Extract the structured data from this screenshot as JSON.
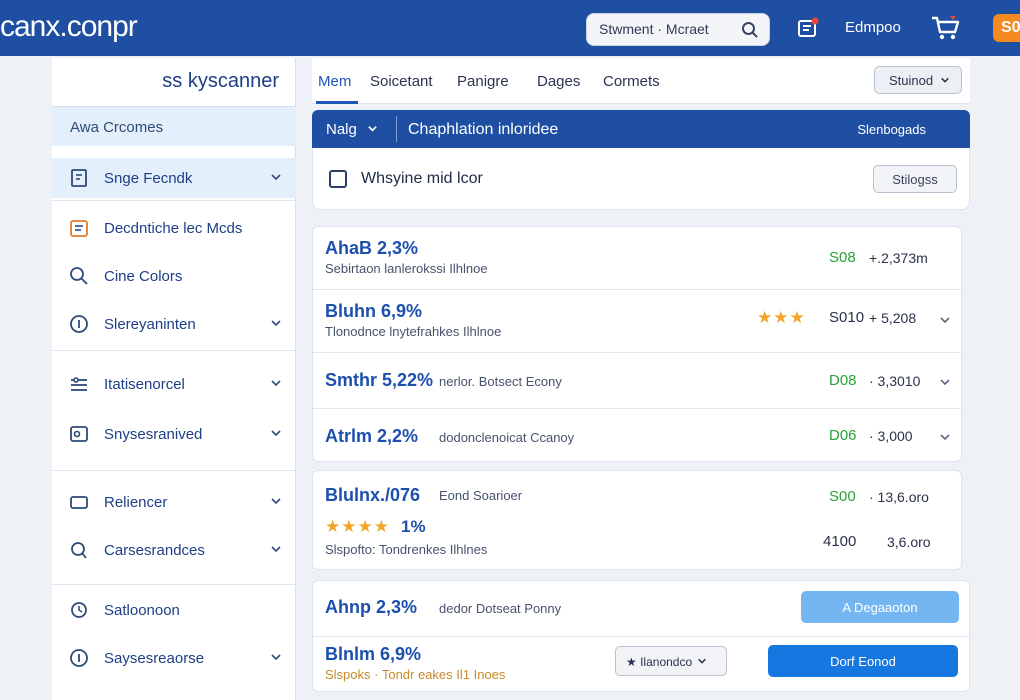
{
  "header": {
    "logo": "canx.conpr",
    "search_value": "Stwment · Mcraet",
    "link": "Edmpoo",
    "badge": "S0"
  },
  "sidebar": {
    "brand": "ss kyscanner",
    "heading": "Awa Crcomes",
    "items": [
      {
        "label": "Snge Fecndk"
      },
      {
        "label": "Decdntiche lec Mcds"
      },
      {
        "label": "Cine Colors"
      },
      {
        "label": "Slereyaninten"
      },
      {
        "label": "Itatisenorcel"
      },
      {
        "label": "Snysesranived"
      },
      {
        "label": "Reliencer"
      },
      {
        "label": "Carsesrandces"
      },
      {
        "label": "Satloonoon"
      },
      {
        "label": "Saysesreaorse"
      }
    ]
  },
  "tabs": {
    "items": [
      "Mem",
      "Soicetant",
      "Panigre",
      "Dages",
      "Cormets"
    ],
    "dropdown": "Stuinod"
  },
  "bluebar": {
    "left": "Nalg",
    "title": "Chaphlation inloridee",
    "right": "Slenbogads"
  },
  "filter": {
    "label": "Whsyine mid lcor",
    "button": "Stilogss"
  },
  "results": {
    "r1": {
      "title": "AhaB 2,3%",
      "sub": "Sebirtaon lanlerokssi Ilhlnoe",
      "price": "S08",
      "amount": "+.2,373m"
    },
    "r2": {
      "title": "Bluhn 6,9%",
      "sub": "Tlonodnce lnytefrahkes Ilhlnoe",
      "stars": "★★★",
      "price": "S010",
      "amount": "+ 5,208"
    },
    "r3": {
      "title": "Smthr 5,22%",
      "inline": "nerlor. Botsect Econy",
      "price": "D08",
      "amount": "· 3,3010"
    },
    "r4": {
      "title": "Atrlm 2,2%",
      "inline": "dodonclenoicat Ccanoy",
      "price": "D06",
      "amount": "· 3,000"
    },
    "r5": {
      "title": "Blulnx./076",
      "inline": "Eond Soarioer",
      "price": "S00",
      "amount": "· 13,6.oro",
      "stars": "★★★★",
      "pct": "1%",
      "sub": "Slspofto: Tondrenkes Ilhlnes",
      "price2": "4100",
      "amount2": "3,6.oro"
    },
    "r6": {
      "title": "Ahnp 2,3%",
      "inline": "dedor Dotseat Ponny",
      "button": "A Degaaoton"
    },
    "r7": {
      "title": "Blnlm 6,9%",
      "sub": "Slspoks · Tondr eakes Il1 Inoes",
      "dropdown": "★ Ilanondco",
      "button": "Dorf Eonod"
    }
  }
}
